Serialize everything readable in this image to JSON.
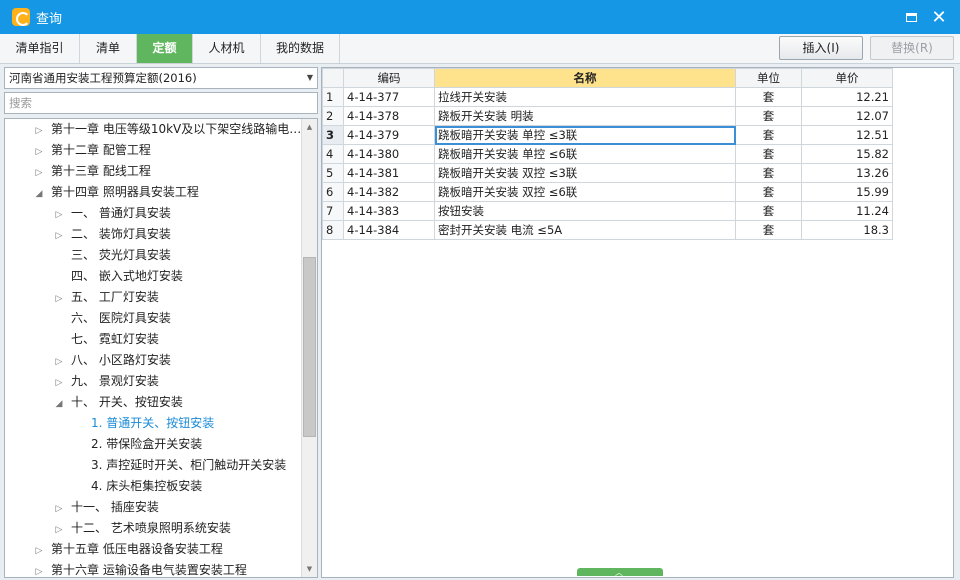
{
  "window": {
    "title": "查询"
  },
  "tabs": [
    {
      "label": "清单指引",
      "active": false
    },
    {
      "label": "清单",
      "active": false
    },
    {
      "label": "定额",
      "active": true
    },
    {
      "label": "人材机",
      "active": false
    },
    {
      "label": "我的数据",
      "active": false
    }
  ],
  "toolbar": {
    "insert_label": "插入(I)",
    "replace_label": "替换(R)"
  },
  "left": {
    "quota_library": "河南省通用安装工程预算定额(2016)",
    "search_placeholder": "搜索"
  },
  "tree": [
    {
      "label": "第十一章 电压等级10kV及以下架空线路输电…",
      "toggle": "▷"
    },
    {
      "label": "第十二章 配管工程",
      "toggle": "▷"
    },
    {
      "label": "第十三章 配线工程",
      "toggle": "▷"
    },
    {
      "label": "第十四章 照明器具安装工程",
      "toggle": "◢"
    },
    {
      "label": "一、 普通灯具安装",
      "toggle": "▷"
    },
    {
      "label": "二、 装饰灯具安装",
      "toggle": "▷"
    },
    {
      "label": "三、 荧光灯具安装",
      "toggle": ""
    },
    {
      "label": "四、 嵌入式地灯安装",
      "toggle": ""
    },
    {
      "label": "五、 工厂灯安装",
      "toggle": "▷"
    },
    {
      "label": "六、 医院灯具安装",
      "toggle": ""
    },
    {
      "label": "七、 霓虹灯安装",
      "toggle": ""
    },
    {
      "label": "八、 小区路灯安装",
      "toggle": "▷"
    },
    {
      "label": "九、 景观灯安装",
      "toggle": "▷"
    },
    {
      "label": "十、 开关、按钮安装",
      "toggle": "◢"
    },
    {
      "label": "1. 普通开关、按钮安装",
      "toggle": ""
    },
    {
      "label": "2. 带保险盒开关安装",
      "toggle": ""
    },
    {
      "label": "3. 声控延时开关、柜门触动开关安装",
      "toggle": ""
    },
    {
      "label": "4. 床头柜集控板安装",
      "toggle": ""
    },
    {
      "label": "十一、 插座安装",
      "toggle": "▷"
    },
    {
      "label": "十二、 艺术喷泉照明系统安装",
      "toggle": "▷"
    },
    {
      "label": "第十五章 低压电器设备安装工程",
      "toggle": "▷"
    },
    {
      "label": "第十六章 运输设备电气装置安装工程",
      "toggle": "▷"
    }
  ],
  "grid": {
    "columns": [
      "编码",
      "名称",
      "单位",
      "单价"
    ],
    "rows": [
      {
        "idx": "1",
        "code": "4-14-377",
        "name": "拉线开关安装",
        "unit": "套",
        "price": "12.21"
      },
      {
        "idx": "2",
        "code": "4-14-378",
        "name": "跷板开关安装 明装",
        "unit": "套",
        "price": "12.07"
      },
      {
        "idx": "3",
        "code": "4-14-379",
        "name": "跷板暗开关安装 单控 ≤3联",
        "unit": "套",
        "price": "12.51"
      },
      {
        "idx": "4",
        "code": "4-14-380",
        "name": "跷板暗开关安装 单控 ≤6联",
        "unit": "套",
        "price": "15.82"
      },
      {
        "idx": "5",
        "code": "4-14-381",
        "name": "跷板暗开关安装 双控 ≤3联",
        "unit": "套",
        "price": "13.26"
      },
      {
        "idx": "6",
        "code": "4-14-382",
        "name": "跷板暗开关安装 双控 ≤6联",
        "unit": "套",
        "price": "15.99"
      },
      {
        "idx": "7",
        "code": "4-14-383",
        "name": "按钮安装",
        "unit": "套",
        "price": "11.24"
      },
      {
        "idx": "8",
        "code": "4-14-384",
        "name": "密封开关安装 电流 ≤5A",
        "unit": "套",
        "price": "18.3"
      }
    ]
  }
}
